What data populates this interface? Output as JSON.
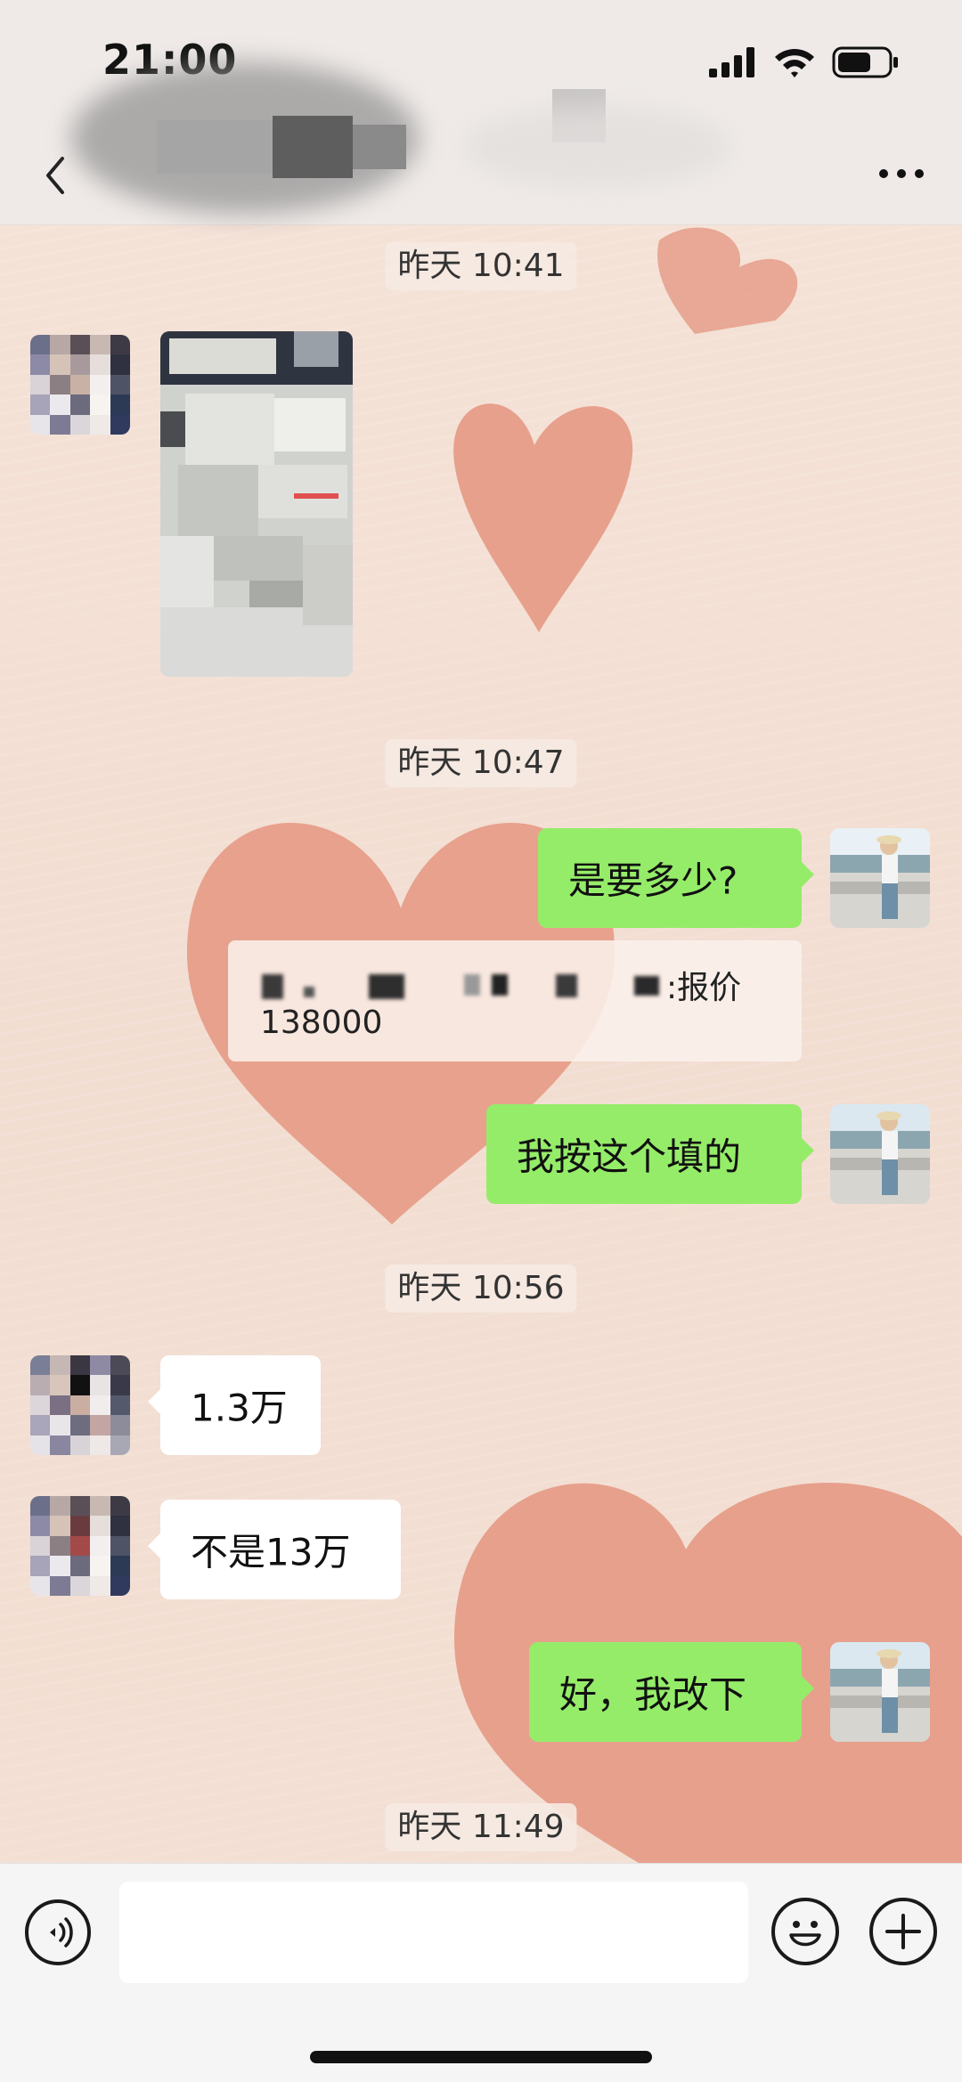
{
  "status_bar": {
    "time": "21:00"
  },
  "nav": {
    "back_icon": "chevron-left-icon",
    "more_icon": "more-dots-icon"
  },
  "timestamps": [
    "昨天 10:41",
    "昨天 10:47",
    "昨天 10:56",
    "昨天 11:49"
  ],
  "messages": {
    "m1": "是要多少?",
    "quote_label": ":报价",
    "quote_value": "138000",
    "m2": "我按这个填的",
    "m3": "1.3万",
    "m4": "不是13万",
    "m5": "好，我改下"
  },
  "colors": {
    "sent_bubble": "#95ec69",
    "received_bubble": "#ffffff",
    "heart": "#e59a85"
  },
  "input_bar": {
    "voice_icon": "voice-icon",
    "emoji_icon": "emoji-icon",
    "plus_icon": "plus-icon"
  }
}
